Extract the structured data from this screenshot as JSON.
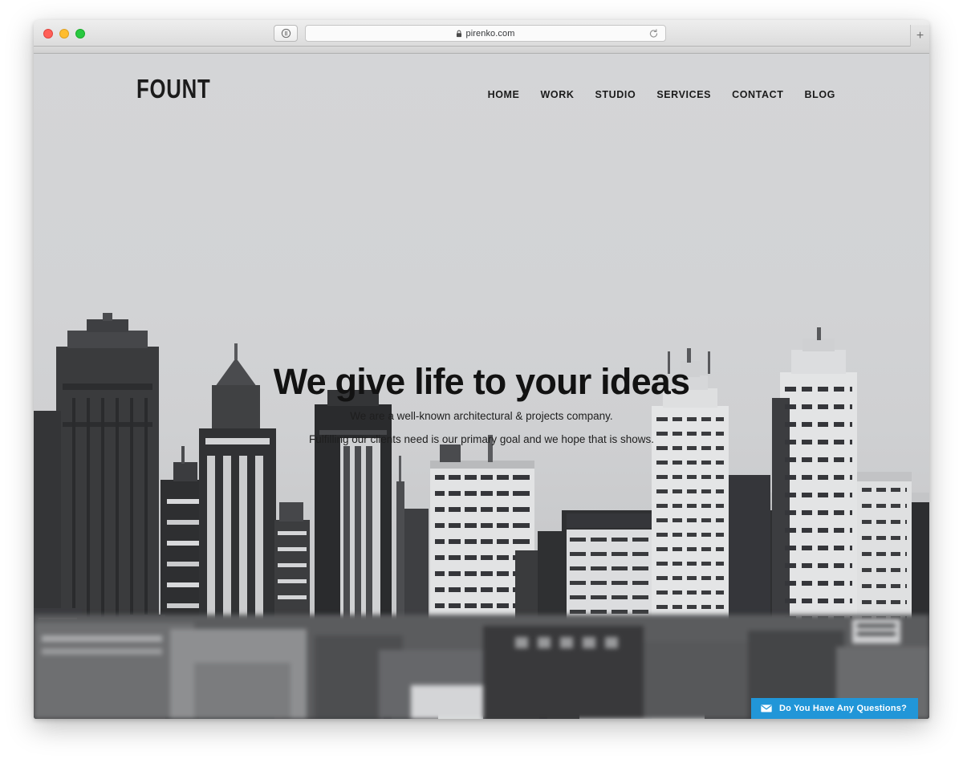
{
  "browser": {
    "url": "pirenko.com",
    "lock_icon": "lock-icon",
    "shield_icon": "shield-icon",
    "reload_icon": "reload-icon",
    "newtab_label": "+",
    "traffic_lights": [
      "close",
      "minimize",
      "maximize"
    ]
  },
  "site": {
    "logo": "FOUNT",
    "nav": [
      {
        "label": "HOME"
      },
      {
        "label": "WORK"
      },
      {
        "label": "STUDIO"
      },
      {
        "label": "SERVICES"
      },
      {
        "label": "CONTACT"
      },
      {
        "label": "BLOG"
      }
    ],
    "hero": {
      "heading": "We give life to your ideas",
      "line1": "We are a well-known architectural & projects company.",
      "line2": "Fulfilling our clients need is our primary goal and we hope that is shows."
    },
    "cta": {
      "label": "Do You Have Any Questions?",
      "icon": "envelope-icon",
      "color": "#2196d8"
    },
    "background": {
      "description": "Black and white tilt-shift city skyline photograph",
      "sky_color": "#d2d3d5"
    }
  }
}
